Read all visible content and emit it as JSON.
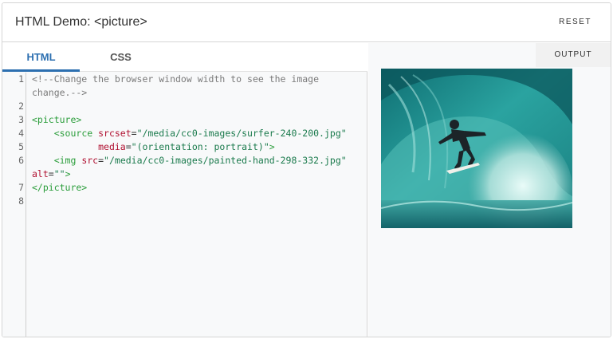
{
  "header": {
    "title": "HTML Demo: <picture>",
    "reset_label": "RESET"
  },
  "tabs": [
    {
      "label": "HTML",
      "active": true
    },
    {
      "label": "CSS",
      "active": false
    }
  ],
  "editor": {
    "lines": [
      {
        "n": "1",
        "tokens": [
          {
            "c": "comment",
            "t": "<!--Change the browser window width to see the image"
          }
        ]
      },
      {
        "n": "",
        "tokens": [
          {
            "c": "comment",
            "t": "change.-->"
          }
        ]
      },
      {
        "n": "2",
        "tokens": []
      },
      {
        "n": "3",
        "tokens": [
          {
            "c": "tag",
            "t": "<picture>"
          }
        ]
      },
      {
        "n": "4",
        "tokens": [
          {
            "c": "plain",
            "t": "    "
          },
          {
            "c": "tag",
            "t": "<source "
          },
          {
            "c": "attr",
            "t": "srcset"
          },
          {
            "c": "plain",
            "t": "="
          },
          {
            "c": "val",
            "t": "\"/media/cc0-images/surfer-240-200.jpg\""
          }
        ]
      },
      {
        "n": "5",
        "tokens": [
          {
            "c": "plain",
            "t": "            "
          },
          {
            "c": "attr",
            "t": "media"
          },
          {
            "c": "plain",
            "t": "="
          },
          {
            "c": "val",
            "t": "\"(orientation: portrait)\""
          },
          {
            "c": "tag",
            "t": ">"
          }
        ]
      },
      {
        "n": "6",
        "tokens": [
          {
            "c": "plain",
            "t": "    "
          },
          {
            "c": "tag",
            "t": "<img "
          },
          {
            "c": "attr",
            "t": "src"
          },
          {
            "c": "plain",
            "t": "="
          },
          {
            "c": "val",
            "t": "\"/media/cc0-images/painted-hand-298-332.jpg\""
          }
        ]
      },
      {
        "n": "",
        "tokens": [
          {
            "c": "attr",
            "t": "alt"
          },
          {
            "c": "plain",
            "t": "="
          },
          {
            "c": "val",
            "t": "\"\""
          },
          {
            "c": "tag",
            "t": ">"
          }
        ]
      },
      {
        "n": "7",
        "tokens": [
          {
            "c": "tag",
            "t": "</picture>"
          }
        ]
      },
      {
        "n": "8",
        "tokens": []
      }
    ]
  },
  "output": {
    "label": "OUTPUT"
  },
  "colors": {
    "accent": "#2c6fb0",
    "tag": "#2a9d3a",
    "attr": "#b01030",
    "value": "#1a7a4c",
    "comment": "#7a7a7a"
  }
}
